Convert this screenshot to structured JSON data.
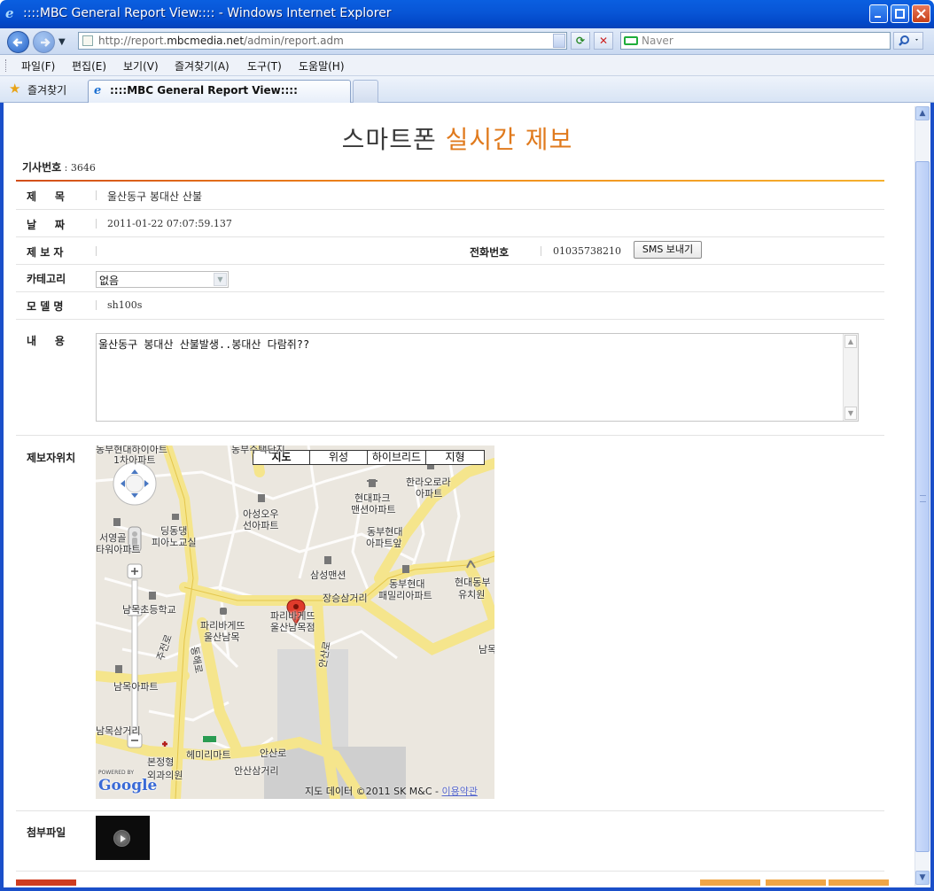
{
  "window": {
    "title": "::::MBC General Report View:::: - Windows Internet Explorer"
  },
  "nav": {
    "url_prefix": "http://report.",
    "url_domain": "mbcmedia.net",
    "url_path": "/admin/report.adm",
    "search_placeholder": "Naver"
  },
  "menu": [
    "파일(F)",
    "편집(E)",
    "보기(V)",
    "즐겨찾기(A)",
    "도구(T)",
    "도움말(H)"
  ],
  "favorites": {
    "label": "즐겨찾기",
    "tab_title": "::::MBC General Report View::::"
  },
  "page": {
    "title_main": "스마트폰 ",
    "title_accent": "실시간 제보",
    "docno_label": "기사번호",
    "docno_value": " : 3646"
  },
  "fields": {
    "subject_label": "제     목",
    "subject_value": "울산동구 봉대산 산불",
    "date_label": "날     짜",
    "date_value": "2011-01-22 07:07:59.137",
    "reporter_label": "제 보 자",
    "phone_label": "전화번호",
    "phone_value": "01035738210",
    "sms_button": "SMS 보내기",
    "category_label": "카테고리",
    "category_value": "없음",
    "model_label": "모 델 명",
    "model_value": "sh100s",
    "content_label": "내     용",
    "content_value": "울산동구 봉대산 산불발생..봉대산 다람쥐??",
    "location_label": "제보자위치",
    "attachment_label": "첨부파일"
  },
  "map": {
    "types": [
      "지도",
      "위성",
      "하이브리드",
      "지형"
    ],
    "labels": [
      "동부현대하이아트",
      "1차아파트",
      "동부주택단지",
      "한라오로라",
      "아파트",
      "현대파크",
      "맨션아파트",
      "아성오우",
      "선아파트",
      "딩동댕",
      "피아노교실",
      "서영골",
      "타워아파트",
      "동부현대",
      "아파트앞",
      "삼성맨션",
      "동부현대",
      "패밀리아파트",
      "현대동부",
      "유치원",
      "장승삼거리",
      "파리바게뜨",
      "울산남목점",
      "파리바게뜨",
      "울산남목",
      "남목초등학교",
      "남목아파트",
      "남목삼거리",
      "헤미리마트",
      "본정형",
      "외과의원",
      "안산로",
      "안산삼거리",
      "주전로",
      "동해로",
      "안산로",
      "남목"
    ],
    "footer_text": "지도 데이터 ©2011 SK M&C - ",
    "footer_link": "이용약관",
    "powered_by": "POWERED BY",
    "google": "Google"
  }
}
